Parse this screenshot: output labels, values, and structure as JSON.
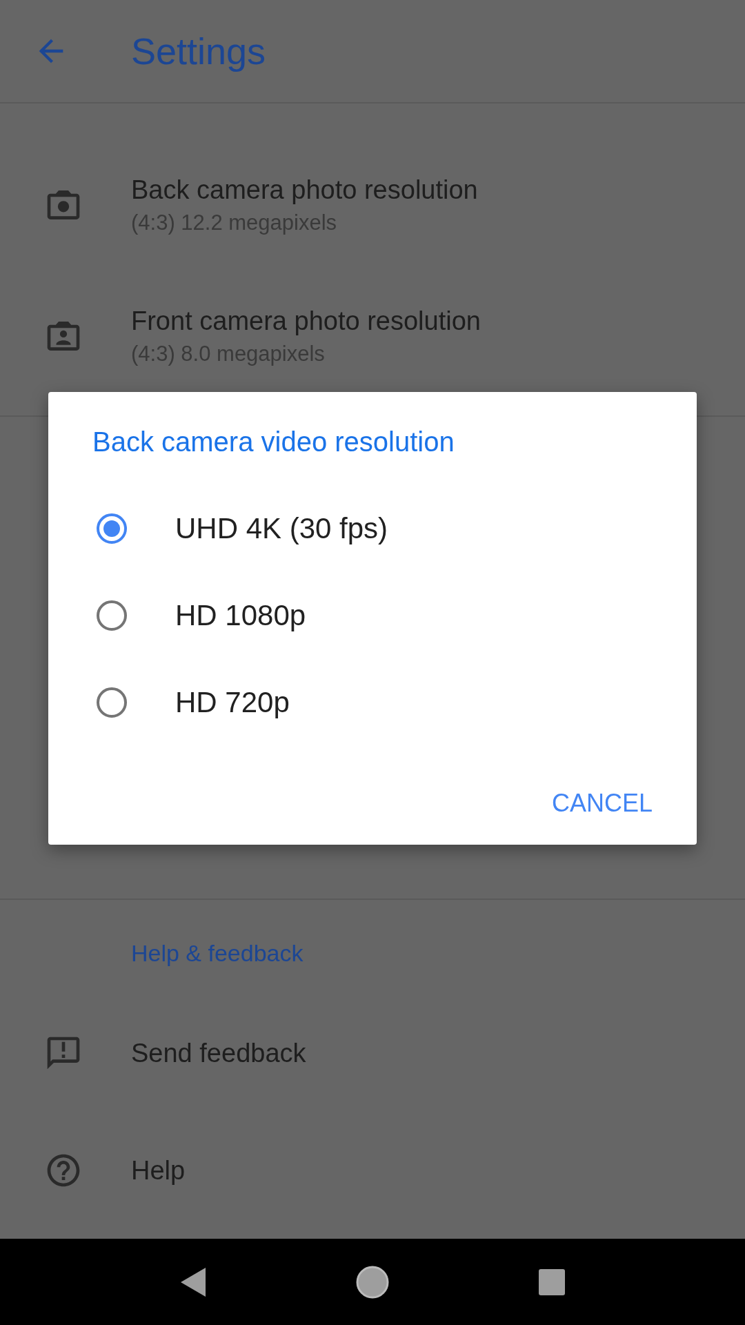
{
  "app_bar": {
    "title": "Settings"
  },
  "sections": [
    {
      "items": [
        {
          "kind": "back-camera",
          "title": "Back camera photo resolution",
          "subtitle": "(4:3) 12.2 megapixels"
        },
        {
          "kind": "front-camera",
          "title": "Front camera photo resolution",
          "subtitle": "(4:3) 8.0 megapixels"
        }
      ]
    },
    {
      "header": "Help & feedback",
      "items": [
        {
          "kind": "feedback",
          "title": "Send feedback"
        },
        {
          "kind": "help",
          "title": "Help"
        }
      ]
    }
  ],
  "dialog": {
    "title": "Back camera video resolution",
    "options": [
      {
        "label": "UHD 4K (30 fps)",
        "selected": true
      },
      {
        "label": "HD 1080p",
        "selected": false
      },
      {
        "label": "HD 720p",
        "selected": false
      }
    ],
    "buttons": [
      "CANCEL"
    ]
  }
}
